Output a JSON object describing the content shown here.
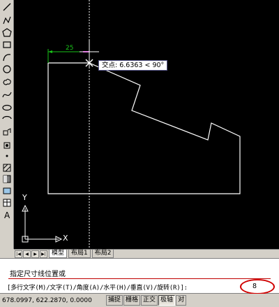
{
  "toolbar": {
    "tools": [
      "line-icon",
      "polyline-icon",
      "polygon-icon",
      "rectangle-icon",
      "arc-icon",
      "circle-icon",
      "revcloud-icon",
      "spline-icon",
      "ellipse-icon",
      "ellipse-arc-icon",
      "insert-block-icon",
      "make-block-icon",
      "point-icon",
      "hatch-icon",
      "gradient-icon",
      "region-icon",
      "table-icon",
      "mtext-icon"
    ]
  },
  "canvas": {
    "dimension_text": "25",
    "tooltip_text": "交点: 6.6363 < 90°",
    "ucs_x_label": "X",
    "ucs_y_label": "Y"
  },
  "tabs": {
    "nav": [
      "|◀",
      "◀",
      "▶",
      "▶|"
    ],
    "items": [
      "模型",
      "布局1",
      "布局2"
    ]
  },
  "command": {
    "line1": "指定尺寸线位置或",
    "line2": "[多行文字(M)/文字(T)/角度(A)/水平(H)/垂直(V)/旋转(R)]:",
    "value": "8"
  },
  "status": {
    "coords": "678.0997, 622.2870, 0.0000",
    "buttons": [
      "捕捉",
      "栅格",
      "正交",
      "极轴",
      "对"
    ]
  },
  "colors": {
    "canvas_bg": "#000000",
    "geometry": "#ffffff",
    "dimension": "#19c219",
    "highlight": "#d00000"
  }
}
